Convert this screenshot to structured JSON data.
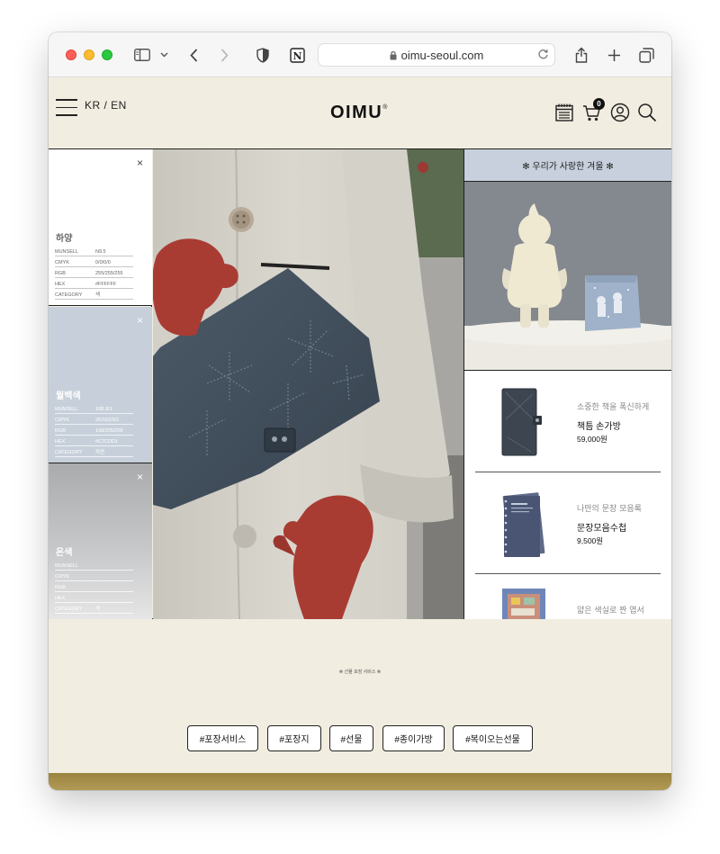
{
  "browser": {
    "url": "oimu-seoul.com"
  },
  "header": {
    "lang_label": "KR / EN",
    "logo": "OIMU",
    "logo_mark": "®",
    "cart_count": "0"
  },
  "swatches": [
    {
      "title": "하양",
      "close": "×",
      "rows": [
        {
          "k": "MUNSELL",
          "v": "N9.5"
        },
        {
          "k": "CMYK",
          "v": "0/0/0/0"
        },
        {
          "k": "RGB",
          "v": "255/255/255"
        },
        {
          "k": "HEX",
          "v": "#FFFFFF"
        },
        {
          "k": "CATEGORY",
          "v": "색"
        }
      ]
    },
    {
      "title": "월백색",
      "close": "×",
      "rows": [
        {
          "k": "MUNSELL",
          "v": "10B 8/1"
        },
        {
          "k": "CMYK",
          "v": "25/16/15/2"
        },
        {
          "k": "RGB",
          "v": "198/205/209"
        },
        {
          "k": "HEX",
          "v": "#C7CDD1"
        },
        {
          "k": "CATEGORY",
          "v": "자연"
        }
      ]
    },
    {
      "title": "은색",
      "close": "×",
      "rows": [
        {
          "k": "MUNSELL",
          "v": ""
        },
        {
          "k": "CMYK",
          "v": ""
        },
        {
          "k": "RGB",
          "v": ""
        },
        {
          "k": "HEX",
          "v": ""
        },
        {
          "k": "CATEGORY",
          "v": "색"
        }
      ]
    }
  ],
  "right": {
    "banner": "✻ 우리가 사랑한 겨울 ✻",
    "products": [
      {
        "tag": "소중한 책을 폭신하게",
        "name": "책틈 손가방",
        "price": "59,000원"
      },
      {
        "tag": "나만의 문장 모음록",
        "name": "문장모음수첩",
        "price": "9,500원"
      },
      {
        "tag": "얇은 색실로 짠 엽서",
        "name": "",
        "price": ""
      }
    ]
  },
  "tags": {
    "caption": "✻ 선물 포장 서비스 ✻",
    "items": [
      "#포장서비스",
      "#포장지",
      "#선물",
      "#종이가방",
      "#복이오는선물"
    ]
  },
  "colors": {
    "page_bg": "#F1EDE0",
    "banner_bg": "#C7D0DC",
    "gray_swatch": "#C7CDD1",
    "bottom_strip": "#A89248"
  }
}
